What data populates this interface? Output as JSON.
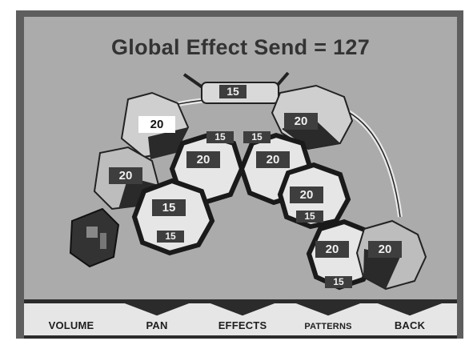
{
  "header": {
    "title": "Global Effect Send = 127"
  },
  "kit": {
    "top_center": "15",
    "left_crash": "20",
    "left_crash_send": "15",
    "right_ride": "20",
    "right_ride_send": "15",
    "tom1": "20",
    "tom2": "20",
    "hihat": "20",
    "snare": "15",
    "snare_send": "15",
    "floor_tom1": "20",
    "floor_tom1_send": "15",
    "floor_tom2": "20",
    "floor_tom2_send": "15",
    "right_crash": "20"
  },
  "toolbar": {
    "volume": "VOLUME",
    "pan": "PAN",
    "effects": "EFFECTS",
    "patterns": "PATTERNS",
    "back": "BACK"
  }
}
